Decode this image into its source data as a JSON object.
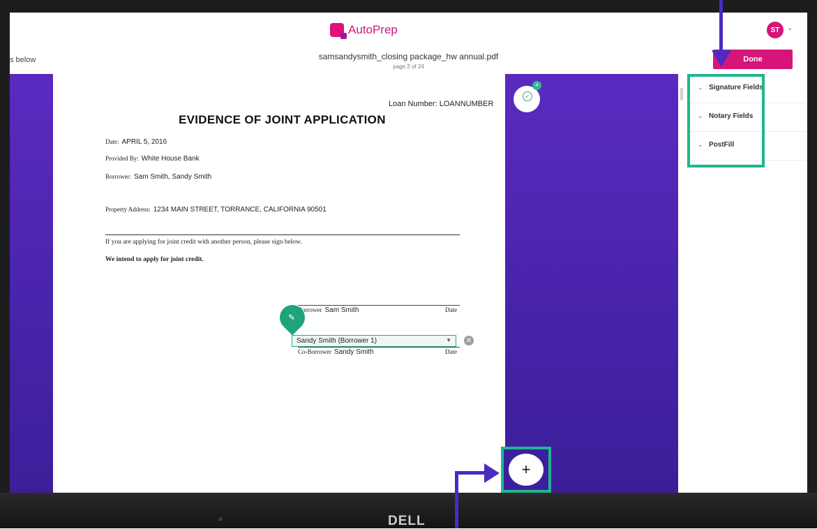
{
  "app": {
    "name": "AutoPrep",
    "brand_color": "#d61579",
    "accent_color": "#1fb68e",
    "arrow_color": "#4c2bc2"
  },
  "user": {
    "initials": "ST"
  },
  "toolbar": {
    "instructions_fragment": "s below",
    "filename": "samsandysmith_closing package_hw annual.pdf",
    "page_info": "page 2 of 24",
    "done_label": "Done"
  },
  "document": {
    "loan_number": "Loan Number: LOANNUMBER",
    "title": "EVIDENCE OF JOINT APPLICATION",
    "date_label": "Date:",
    "date_value": "APRIL 5, 2016",
    "provided_label": "Provided By:",
    "provided_value": "White House Bank",
    "borrower_label": "Borrower:",
    "borrower_value": "Sam Smith, Sandy Smith",
    "property_label": "Property Address:",
    "property_value": "1234 MAIN STREET, TORRANCE, CALIFORNIA 90501",
    "para1": "If you are applying for joint credit with another person, please sign below.",
    "para2": "We intend to apply for joint credit.",
    "sig1_label": "Borrower",
    "sig1_name": "Sam Smith",
    "sig1_date": "Date",
    "sig2_label": "Co-Borrower",
    "sig2_name": "Sandy Smith",
    "sig2_date": "Date",
    "signer_select_value": "Sandy Smith (Borrower 1)"
  },
  "badge": {
    "count": "4"
  },
  "side_panel": {
    "items": [
      {
        "label": "Signature Fields"
      },
      {
        "label": "Notary Fields"
      },
      {
        "label": "PostFill"
      }
    ]
  },
  "add_button": {
    "label": "+"
  },
  "laptop": {
    "brand": "DELL"
  }
}
